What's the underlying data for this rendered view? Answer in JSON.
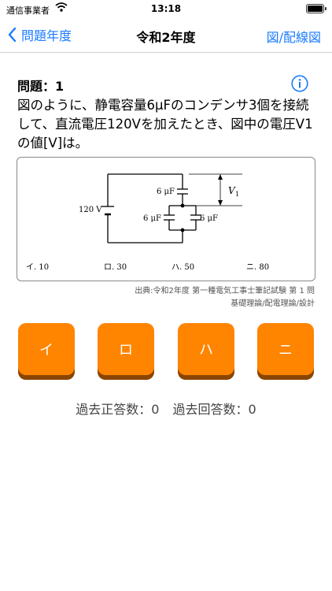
{
  "status_bar": {
    "carrier": "通信事業者",
    "time": "13:18",
    "battery_level": 1.0
  },
  "nav": {
    "back_label": "問題年度",
    "title": "令和2年度",
    "right_label": "図/配線図"
  },
  "question": {
    "label": "問題：1",
    "text": "図のように、静電容量6μFのコンデンサ3個を接続して、直流電圧120Vを加えたとき、図中の電圧V1の値[V]は。"
  },
  "figure": {
    "voltage_label": "120 V",
    "cap_top_label": "6 μF",
    "cap_left_label": "6 μF",
    "cap_right_label": "6 μF",
    "v1_label": "V",
    "v1_sub": "1",
    "options": [
      "イ. 10",
      "ロ. 30",
      "ハ. 50",
      "ニ. 80"
    ]
  },
  "source": {
    "line1": "出典:令和2年度 第一種電気工事士筆記試験 第 1 問",
    "line2": "基礎理論/配電理論/設計"
  },
  "answers": [
    "イ",
    "ロ",
    "ハ",
    "ニ"
  ],
  "stats": {
    "correct": "過去正答数：0",
    "attempts": "過去回答数：0"
  },
  "colors": {
    "accent": "#1a7bff",
    "button": "#ff8400",
    "button_shadow": "#8a4503"
  },
  "icons": [
    "wifi-icon",
    "chevron-left-icon",
    "info-icon"
  ]
}
